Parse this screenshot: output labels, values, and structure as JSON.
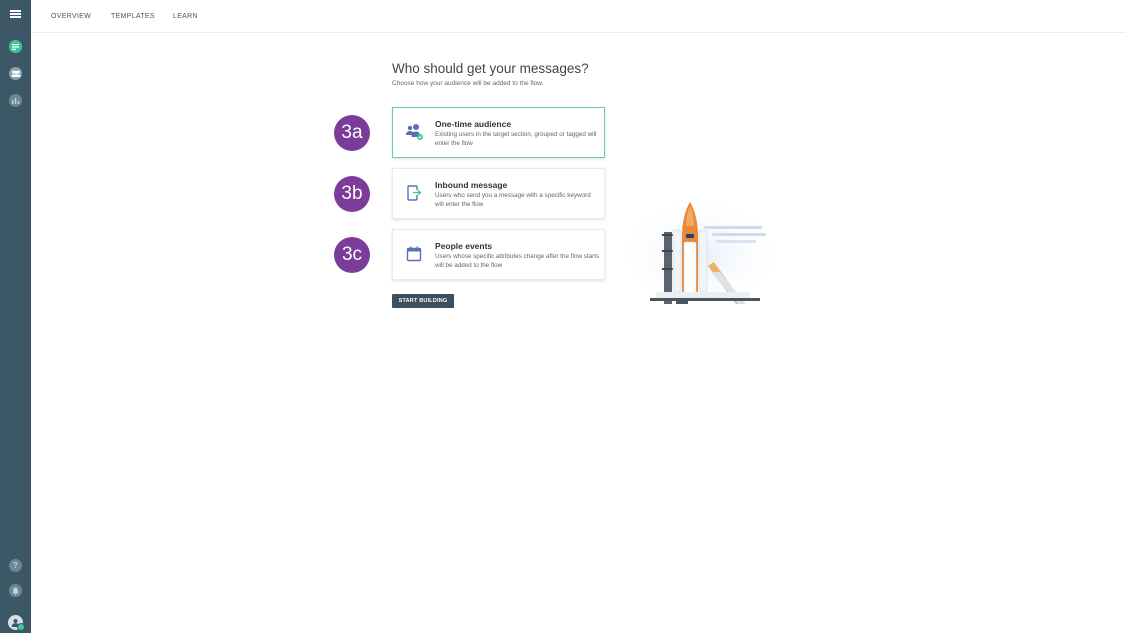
{
  "nav": {
    "tabs": [
      {
        "label": "OVERVIEW"
      },
      {
        "label": "TEMPLATES"
      },
      {
        "label": "LEARN"
      }
    ]
  },
  "sidebar": {
    "items": [
      {
        "name": "menu",
        "icon": "hamburger-icon"
      },
      {
        "name": "flows",
        "icon": "chat-bubble-icon",
        "active": true
      },
      {
        "name": "people",
        "icon": "people-group-icon"
      },
      {
        "name": "statistics",
        "icon": "bar-chart-icon"
      }
    ],
    "help_label": "?",
    "bottom": [
      {
        "name": "help",
        "icon": "help-icon"
      },
      {
        "name": "notifications",
        "icon": "bell-icon"
      },
      {
        "name": "account",
        "icon": "user-avatar-icon"
      }
    ]
  },
  "main": {
    "heading": "Who should get your messages?",
    "subheading": "Choose how your audience will be added to the flow.",
    "options": [
      {
        "step": "3a",
        "icon": "audience-icon",
        "title": "One-time audience",
        "description": "Existing users in the target section, grouped or tagged will enter the flow",
        "selected": true
      },
      {
        "step": "3b",
        "icon": "inbound-message-icon",
        "title": "Inbound message",
        "description": "Users who send you a message with a specific keyword will enter the flow",
        "selected": false
      },
      {
        "step": "3c",
        "icon": "calendar-icon",
        "title": "People events",
        "description": "Users whose specific attributes change after the flow starts will be added to the flow",
        "selected": false
      }
    ],
    "start_button": "START BUILDING"
  },
  "colors": {
    "sidebar_bg": "#3c5766",
    "accent_green": "#3fc79b",
    "step_badge": "#7b3b99",
    "button_bg": "#3a5060",
    "icon_blue": "#5a6fb5"
  }
}
